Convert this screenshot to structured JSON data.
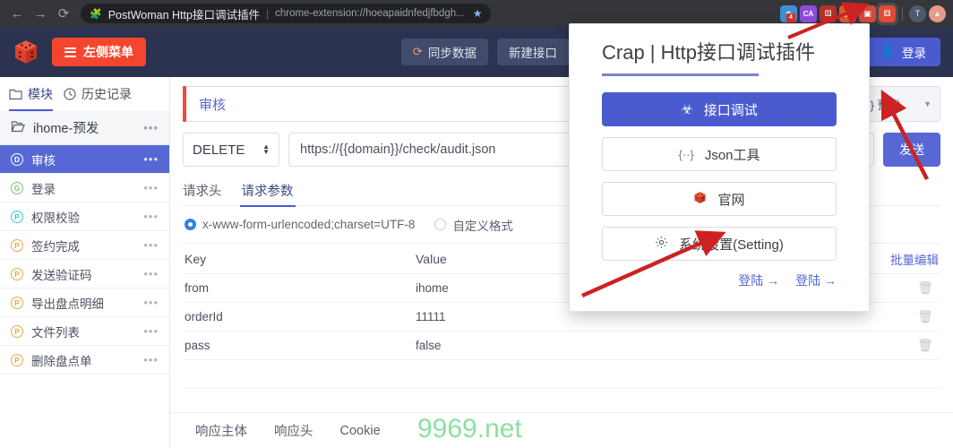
{
  "browser": {
    "back_icon": "back-arrow-icon",
    "forward_icon": "forward-arrow-icon",
    "reload_icon": "reload-icon",
    "puzzle_icon": "puzzle-piece-icon",
    "tab_title": "PostWoman Http接口调试插件",
    "separator": "|",
    "url": "chrome-extension://hoeapaidnfedjfbdgh...",
    "star_icon": "star-icon",
    "extensions": [
      {
        "name": "ext-icon-blue",
        "color": "#3f8fd6",
        "glyph": "⚯",
        "badge": "4"
      },
      {
        "name": "ext-icon-purple",
        "color": "#8e4ddb",
        "glyph": "CA",
        "badge": ""
      },
      {
        "name": "ext-icon-dice-small",
        "color": "#b3332a",
        "glyph": "⚄",
        "badge": ""
      },
      {
        "name": "ext-icon-terminal",
        "color": "#e8542f",
        "glyph": "▤",
        "badge": ""
      },
      {
        "name": "ext-icon-image",
        "color": "#d04a3a",
        "glyph": "▥",
        "badge": ""
      },
      {
        "name": "ext-icon-crap-dice",
        "color": "#e04a36",
        "glyph": "⚅",
        "badge": ""
      }
    ],
    "profile_letter": "T",
    "update_icon": "up-arrow-icon"
  },
  "app_header": {
    "logo": "dice-logo-icon",
    "menu_button": {
      "label": "左侧菜单",
      "icon": "hamburger-icon"
    },
    "buttons": [
      {
        "label": "同步数据",
        "icon": "refresh-icon"
      },
      {
        "label": "新建接口",
        "icon": ""
      },
      {
        "label": "",
        "icon": "chat-icon"
      }
    ],
    "login_button": {
      "label": "登录",
      "icon": "user-icon"
    }
  },
  "sidebar": {
    "tabs": [
      {
        "label": "模块",
        "icon": "folder-icon",
        "active": true
      },
      {
        "label": "历史记录",
        "icon": "clock-icon",
        "active": false
      }
    ],
    "group": {
      "label": "ihome-预发",
      "icon": "folder-open-icon",
      "more": "•••"
    },
    "items": [
      {
        "label": "审核",
        "method": "D",
        "method_class": "m-D",
        "selected": true,
        "more": "•••"
      },
      {
        "label": "登录",
        "method": "G",
        "method_class": "m-G",
        "selected": false,
        "more": "•••"
      },
      {
        "label": "权限校验",
        "method": "P",
        "method_class": "m-Pc",
        "selected": false,
        "more": "•••"
      },
      {
        "label": "签约完成",
        "method": "P",
        "method_class": "m-P",
        "selected": false,
        "more": "•••"
      },
      {
        "label": "发送验证码",
        "method": "P",
        "method_class": "m-P",
        "selected": false,
        "more": "•••"
      },
      {
        "label": "导出盘点明细",
        "method": "P",
        "method_class": "m-P",
        "selected": false,
        "more": "•••"
      },
      {
        "label": "文件列表",
        "method": "P",
        "method_class": "m-P",
        "selected": false,
        "more": "•••"
      },
      {
        "label": "删除盘点单",
        "method": "P",
        "method_class": "m-P",
        "selected": false,
        "more": "•••"
      }
    ]
  },
  "request": {
    "name": "审核",
    "env_selector": {
      "label": "{n} 预发",
      "caret": "▼"
    },
    "method": "DELETE",
    "url": "https://{{domain}}/check/audit.json",
    "send_label": "发送",
    "tabs": [
      {
        "label": "请求头",
        "active": false
      },
      {
        "label": "请求参数",
        "active": true
      }
    ],
    "encoding": [
      {
        "label": "x-www-form-urlencoded;charset=UTF-8",
        "checked": true
      },
      {
        "label": "自定义格式",
        "checked": false
      }
    ],
    "bulk_edit_label": "批量编辑",
    "table": {
      "headers": [
        "Key",
        "Value"
      ],
      "rows": [
        {
          "key": "from",
          "value": "ihome",
          "delete_icon": "trash-icon"
        },
        {
          "key": "orderId",
          "value": "11111",
          "delete_icon": "trash-icon"
        },
        {
          "key": "pass",
          "value": "false",
          "delete_icon": "trash-icon"
        },
        {
          "key": "",
          "value": "",
          "delete_icon": ""
        }
      ]
    }
  },
  "response": {
    "tabs": [
      {
        "label": "响应主体"
      },
      {
        "label": "响应头"
      },
      {
        "label": "Cookie"
      }
    ]
  },
  "popup": {
    "title": "Crap | Http接口调试插件",
    "buttons": [
      {
        "label": "接口调试",
        "icon": "bug-icon",
        "primary": true
      },
      {
        "label": "Json工具",
        "icon": "braces-icon",
        "primary": false
      },
      {
        "label": "官网",
        "icon": "dice-icon",
        "primary": false
      },
      {
        "label": "系统设置(Setting)",
        "icon": "gear-icon",
        "primary": false
      }
    ],
    "links": [
      {
        "label": "登陆 →"
      },
      {
        "label": "登陆 →"
      }
    ]
  },
  "watermark": {
    "text": "9969.net",
    "color": "#84e09a"
  },
  "annotations": {
    "arrow_color": "#cc2222",
    "arrows": [
      {
        "name": "arrow-to-extension-icon"
      },
      {
        "name": "arrow-to-env-selector"
      },
      {
        "name": "arrow-to-system-setting"
      }
    ]
  }
}
